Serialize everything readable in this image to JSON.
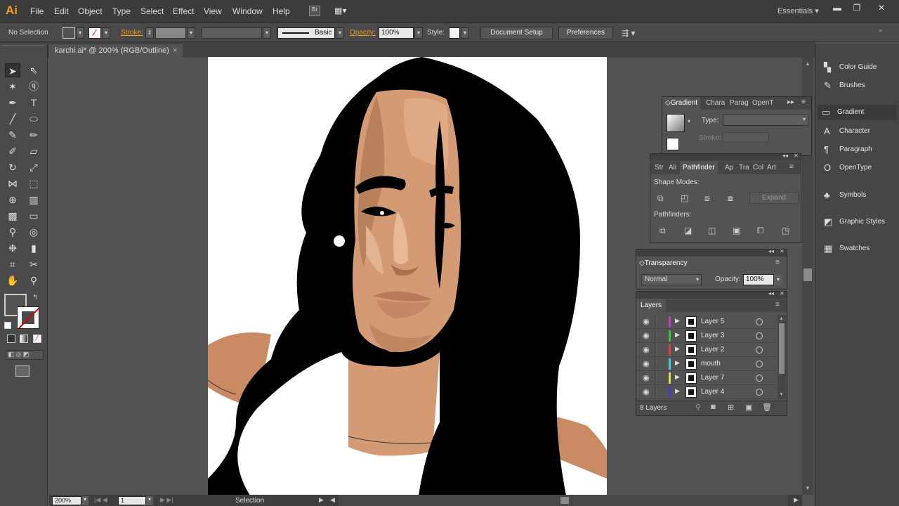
{
  "app": {
    "logo": "Ai",
    "workspace": "Essentials"
  },
  "menu": [
    "File",
    "Edit",
    "Object",
    "Type",
    "Select",
    "Effect",
    "View",
    "Window",
    "Help"
  ],
  "control": {
    "selection": "No Selection",
    "stroke_label": "Stroke:",
    "brush": "Basic",
    "opacity_label": "Opacity:",
    "opacity": "100%",
    "style_label": "Style:",
    "document_setup": "Document Setup",
    "preferences": "Preferences"
  },
  "document": {
    "tab": "karchi.ai* @ 200% (RGB/Outline)"
  },
  "status": {
    "zoom": "200%",
    "page": "1",
    "tool": "Selection"
  },
  "dock": [
    "Color Guide",
    "Brushes",
    "Gradient",
    "Character",
    "Paragraph",
    "OpenType",
    "Symbols",
    "Graphic Styles",
    "Swatches"
  ],
  "gradient_panel": {
    "tabs": [
      "Gradient",
      "Chara",
      "Parag",
      "OpenT"
    ],
    "type_label": "Type:",
    "stroke_label": "Stroke:"
  },
  "pathfinder_panel": {
    "tabs": [
      "Str",
      "Ali",
      "Pathfinder",
      "Ap",
      "Tra",
      "Col",
      "Art"
    ],
    "shape_modes": "Shape Modes:",
    "pathfinders": "Pathfinders:",
    "expand": "Expand"
  },
  "transparency_panel": {
    "title": "Transparency",
    "mode": "Normal",
    "opacity_label": "Opacity:",
    "opacity": "100%"
  },
  "layers_panel": {
    "title": "Layers",
    "count": "8 Layers",
    "layers": [
      {
        "name": "Layer 5",
        "color": "#c040c0"
      },
      {
        "name": "Layer 3",
        "color": "#40c040"
      },
      {
        "name": "Layer 2",
        "color": "#e04040"
      },
      {
        "name": "mouth",
        "color": "#40d0e0"
      },
      {
        "name": "Layer 7",
        "color": "#e0e040"
      },
      {
        "name": "Layer 4",
        "color": "#4040d0"
      }
    ]
  },
  "colors": {
    "accent": "#f29d1a",
    "skin": "#d39a74",
    "skin_light": "#e4b392",
    "skin_shadow": "#b9805c",
    "hair": "#000000"
  }
}
